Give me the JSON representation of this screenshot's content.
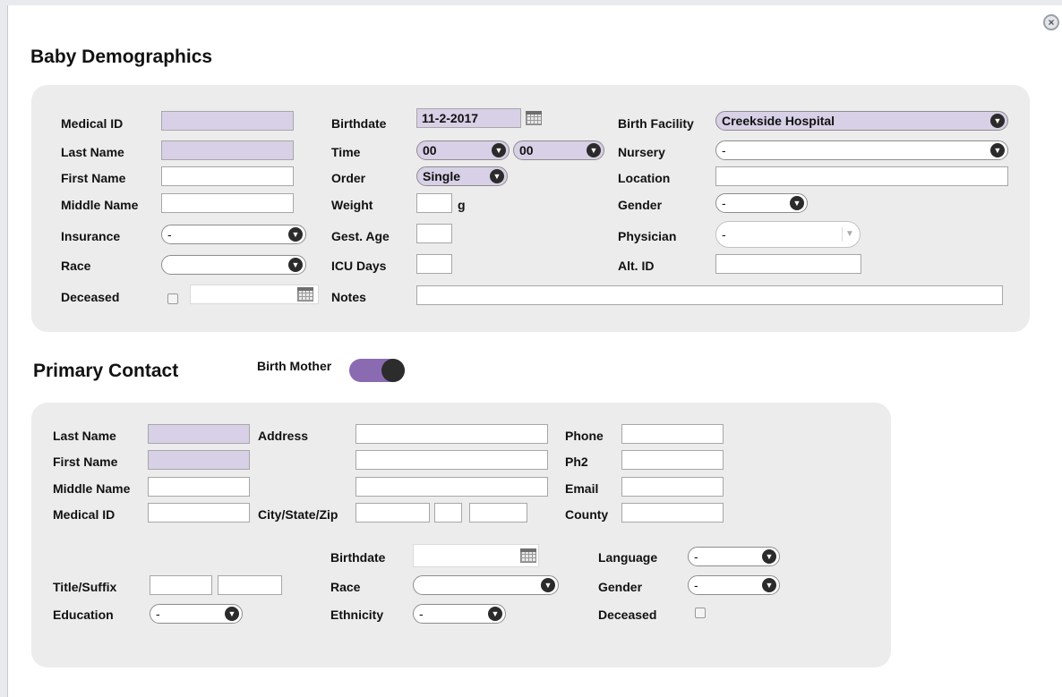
{
  "dialog": {
    "close_glyph": "×"
  },
  "baby": {
    "title": "Baby Demographics",
    "labels": {
      "medical_id": "Medical ID",
      "last_name": "Last Name",
      "first_name": "First Name",
      "middle_name": "Middle Name",
      "insurance": "Insurance",
      "race": "Race",
      "deceased": "Deceased",
      "birthdate": "Birthdate",
      "time": "Time",
      "order": "Order",
      "weight": "Weight",
      "weight_unit": "g",
      "gest_age": "Gest. Age",
      "icu_days": "ICU Days",
      "notes": "Notes",
      "birth_facility": "Birth Facility",
      "nursery": "Nursery",
      "location": "Location",
      "gender": "Gender",
      "physician": "Physician",
      "alt_id": "Alt. ID"
    },
    "values": {
      "medical_id": "",
      "last_name": "",
      "first_name": "",
      "middle_name": "",
      "insurance": "-",
      "race": "",
      "deceased_date": "",
      "birthdate": "11-2-2017",
      "time_hour": "00",
      "time_minute": "00",
      "order": "Single",
      "weight": "",
      "gest_age": "",
      "icu_days": "",
      "notes": "",
      "birth_facility": "Creekside Hospital",
      "nursery": "-",
      "location": "",
      "gender": "-",
      "physician": "-",
      "alt_id": ""
    }
  },
  "contact": {
    "title": "Primary Contact",
    "toggle_label": "Birth Mother",
    "toggle_on": true,
    "labels": {
      "last_name": "Last Name",
      "first_name": "First Name",
      "middle_name": "Middle Name",
      "medical_id": "Medical ID",
      "address": "Address",
      "city_state_zip": "City/State/Zip",
      "phone": "Phone",
      "ph2": "Ph2",
      "email": "Email",
      "county": "County",
      "birthdate": "Birthdate",
      "race": "Race",
      "ethnicity": "Ethnicity",
      "title_suffix": "Title/Suffix",
      "education": "Education",
      "language": "Language",
      "gender": "Gender",
      "deceased": "Deceased"
    },
    "values": {
      "race": "",
      "ethnicity": "-",
      "education": "-",
      "language": "-",
      "gender": "-"
    }
  }
}
